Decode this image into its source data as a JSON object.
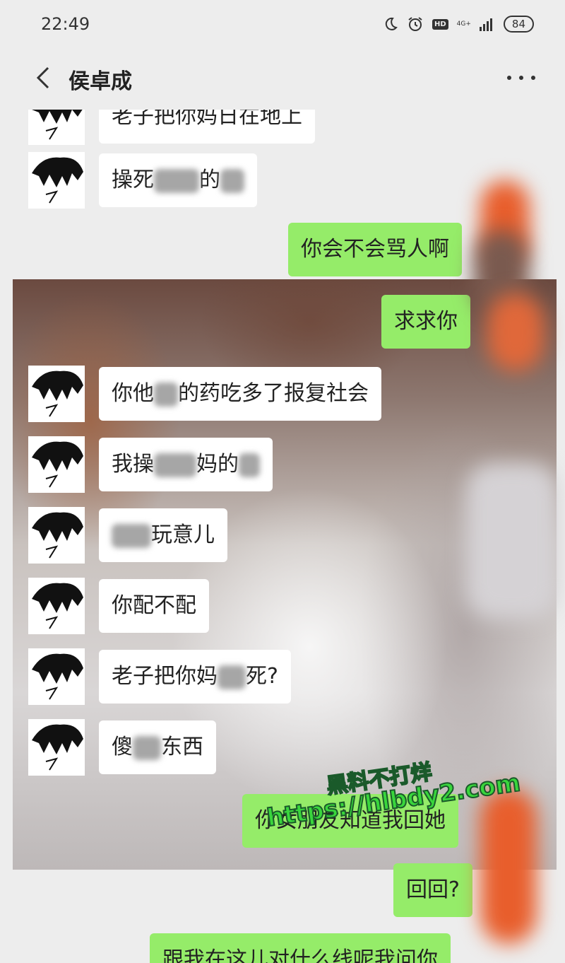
{
  "status_bar": {
    "time": "22:49",
    "network": "4G+",
    "battery": "84"
  },
  "header": {
    "title": "侯卓成"
  },
  "messages": [
    {
      "side": "left",
      "text": "老子把你妈日在地上"
    },
    {
      "side": "left",
      "text_a": "操死",
      "text_b": "的",
      "hidden_label": "操死…的…"
    },
    {
      "side": "right",
      "text": "你会不会骂人啊"
    },
    {
      "side": "right",
      "text": "求求你"
    },
    {
      "side": "left",
      "text_a": "你他",
      "text_b": "的药吃多了报复社会"
    },
    {
      "side": "left",
      "text_a": "我操",
      "text_b": "妈的"
    },
    {
      "side": "left",
      "text_b": "玩意儿"
    },
    {
      "side": "left",
      "text": "你配不配"
    },
    {
      "side": "left",
      "text_a": "老子把你妈",
      "text_b": "死?"
    },
    {
      "side": "left",
      "text_a": "傻",
      "text_b": "东西"
    },
    {
      "side": "right",
      "text": "你女朋友知道我回她"
    },
    {
      "side": "right",
      "text": "回回?"
    },
    {
      "side": "right",
      "text": "跟我在这儿对什么线呢我问你"
    }
  ],
  "watermark": {
    "line1": "黑料不打烊",
    "line2": "https://hlbdy2.com"
  }
}
